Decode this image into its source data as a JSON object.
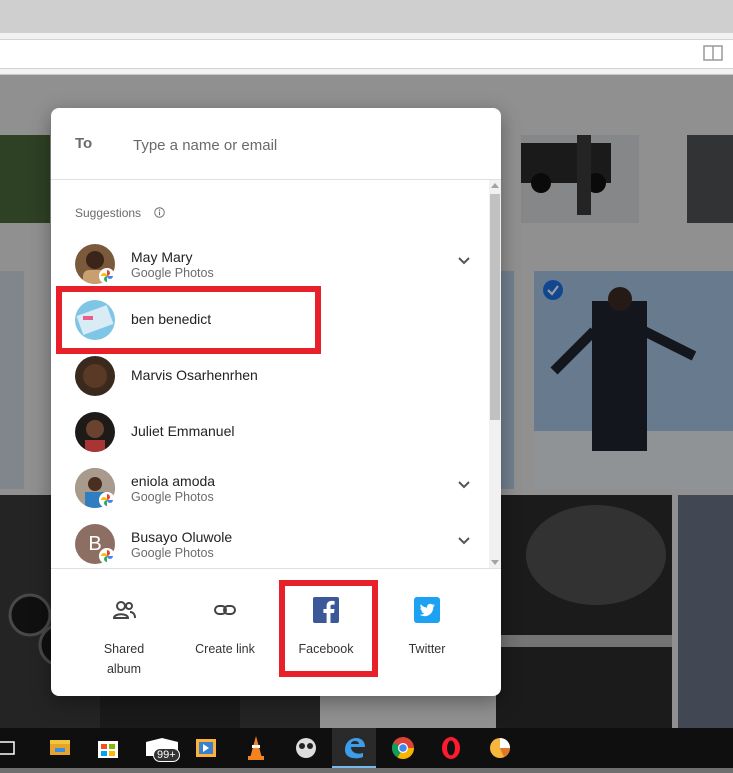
{
  "dialog": {
    "to_label": "To",
    "to_placeholder": "Type a name or email",
    "suggestions_title": "Suggestions",
    "contacts": [
      {
        "name": "May Mary",
        "subtitle": "Google Photos",
        "avatar_color": "#7a5a3a",
        "has_chevron": true
      },
      {
        "name": "ben benedict",
        "subtitle": "",
        "avatar_color": "#7fc6e6",
        "has_chevron": false
      },
      {
        "name": "Marvis Osarhenrhen",
        "subtitle": "",
        "avatar_color": "#3a2a1e",
        "has_chevron": false
      },
      {
        "name": "Juliet Emmanuel",
        "subtitle": "",
        "avatar_color": "#1e1a18",
        "has_chevron": false
      },
      {
        "name": "eniola amoda",
        "subtitle": "Google Photos",
        "avatar_color": "#8a7766",
        "has_chevron": true
      },
      {
        "name": "Busayo Oluwole",
        "subtitle": "Google Photos",
        "avatar_color": "#8d6e63",
        "initial": "B",
        "has_chevron": true
      }
    ],
    "share_options": [
      {
        "label": "Shared album",
        "icon": "people-icon"
      },
      {
        "label": "Create link",
        "icon": "link-icon"
      },
      {
        "label": "Facebook",
        "icon": "facebook-icon"
      },
      {
        "label": "Twitter",
        "icon": "twitter-icon"
      }
    ]
  },
  "taskbar": {
    "items": [
      "task-view-icon",
      "file-explorer-icon",
      "store-icon",
      "mail-icon",
      "media-player-icon",
      "vlc-icon",
      "app-icon",
      "edge-icon",
      "chrome-icon",
      "opera-icon",
      "pie-app-icon"
    ],
    "badge": "99+"
  },
  "colors": {
    "highlight_red": "#e8202a",
    "facebook_blue": "#3b5998",
    "twitter_blue": "#1da1f2",
    "selected_check": "#1a73e8"
  }
}
